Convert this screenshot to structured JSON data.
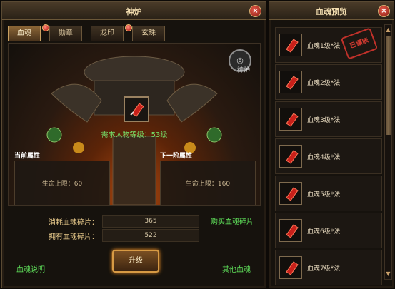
{
  "left_window": {
    "title": "神炉",
    "close": "×",
    "tabs": [
      "血魂",
      "勋章",
      "龙印",
      "玄珠"
    ],
    "active_tab": "血魂",
    "emblem_glyph": "◎",
    "emblem_label": "神炉",
    "item_icon": "blood-soul-gem",
    "requirement": "需求人物等级：53级",
    "current_attr_title": "当前属性",
    "next_attr_title": "下一阶属性",
    "current_value": "生命上限：60",
    "next_value": "生命上限：160",
    "consume_label": "消耗血魂碎片：",
    "consume_value": "365",
    "own_label": "拥有血魂碎片：",
    "own_value": "522",
    "buy_link": "购买血魂碎片",
    "upgrade_button": "升级",
    "help_link": "血魂说明",
    "other_link": "其他血魂"
  },
  "right_window": {
    "title": "血魂预览",
    "close": "×",
    "items": [
      {
        "name": "血魂1级*法",
        "stamp": "已镶嵌"
      },
      {
        "name": "血魂2级*法"
      },
      {
        "name": "血魂3级*法"
      },
      {
        "name": "血魂4级*法"
      },
      {
        "name": "血魂5级*法"
      },
      {
        "name": "血魂6级*法"
      },
      {
        "name": "血魂7级*法"
      }
    ],
    "scroll_up": "▲",
    "scroll_down": "▼"
  },
  "colors": {
    "accent_gold": "#d79a44",
    "link_green": "#5fe05a",
    "close_red": "#b3120c"
  }
}
